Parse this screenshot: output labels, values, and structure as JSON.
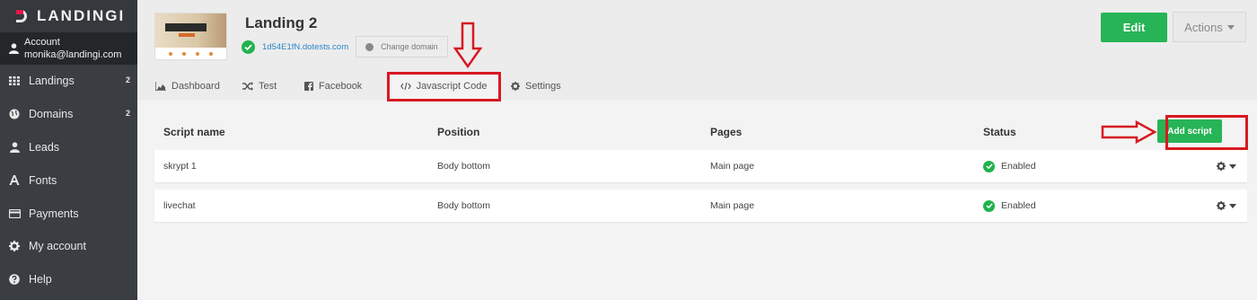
{
  "app": {
    "logo_text": "LANDINGI",
    "accent": "#e5164d"
  },
  "account": {
    "label": "Account",
    "email": "monika@landingi.com"
  },
  "sidebar": {
    "items": [
      {
        "label": "Landings",
        "badge": "2",
        "icon": "grid-icon"
      },
      {
        "label": "Domains",
        "badge": "2",
        "icon": "globe-icon"
      },
      {
        "label": "Leads",
        "badge": "",
        "icon": "user-icon"
      },
      {
        "label": "Fonts",
        "badge": "",
        "icon": "font-icon"
      },
      {
        "label": "Payments",
        "badge": "",
        "icon": "credit-card-icon"
      },
      {
        "label": "My account",
        "badge": "",
        "icon": "gear-icon"
      },
      {
        "label": "Help",
        "badge": "",
        "icon": "question-icon"
      }
    ]
  },
  "header": {
    "title": "Landing 2",
    "domain": "1d54E1fN.dotests.com",
    "change_domain": "Change domain",
    "edit_label": "Edit",
    "actions_label": "Actions",
    "thumbnail_text": "Converting Images"
  },
  "tabs": [
    {
      "label": "Dashboard",
      "icon": "area-chart-icon"
    },
    {
      "label": "Test",
      "icon": "shuffle-icon"
    },
    {
      "label": "Facebook",
      "icon": "facebook-icon"
    },
    {
      "label": "Javascript Code",
      "icon": "code-icon",
      "active": true
    },
    {
      "label": "Settings",
      "icon": "gear-icon"
    }
  ],
  "table": {
    "headers": [
      "Script name",
      "Position",
      "Pages",
      "Status"
    ],
    "add_label": "Add script",
    "rows": [
      {
        "name": "skrypt 1",
        "position": "Body bottom",
        "pages": "Main page",
        "status": "Enabled"
      },
      {
        "name": "livechat",
        "position": "Body bottom",
        "pages": "Main page",
        "status": "Enabled"
      }
    ]
  },
  "colors": {
    "green": "#27b456",
    "sidebar": "#3a3d42",
    "annotation": "#d71920",
    "link": "#2b86c6"
  }
}
